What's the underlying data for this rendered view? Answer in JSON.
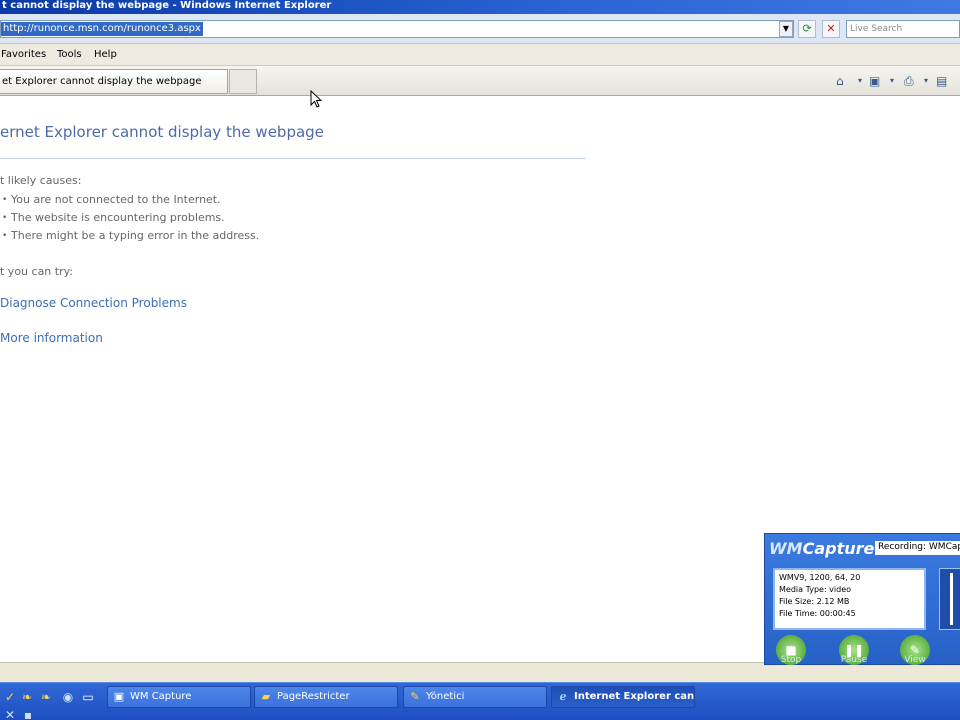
{
  "window": {
    "title": "t cannot display the webpage - Windows Internet Explorer"
  },
  "address_bar": {
    "url": "http://runonce.msn.com/runonce3.aspx",
    "search_placeholder": "Live Search"
  },
  "menu": {
    "items": [
      "Favorites",
      "Tools",
      "Help"
    ]
  },
  "tab": {
    "label": "et Explorer cannot display the webpage"
  },
  "page": {
    "heading": "ernet Explorer cannot display the webpage",
    "causes_label": "t likely causes:",
    "causes": [
      "You are not connected to the Internet.",
      "The website is encountering problems.",
      "There might be a typing error in the address."
    ],
    "try_label": "t you can try:",
    "links": [
      "Diagnose Connection Problems",
      "More information"
    ]
  },
  "wmcapture": {
    "logo_prefix": "WM",
    "logo_suffix": "Capture",
    "status": "Recording: WMCap",
    "info_lines": [
      "WMV9, 1200, 64, 20",
      "Media Type: video",
      "File Size: 2.12 MB",
      "File Time: 00:00:45"
    ],
    "buttons": [
      "Stop",
      "Pause",
      "View"
    ]
  },
  "taskbar": {
    "tasks": [
      {
        "label": "WM Capture",
        "active": false
      },
      {
        "label": "PageRestricter",
        "active": false
      },
      {
        "label": "Yönetici",
        "active": false
      },
      {
        "label": "Internet Explorer can...",
        "active": true
      }
    ]
  },
  "colors": {
    "heading": "#4e6aa6",
    "link": "#3b6eb6",
    "taskbar": "#2458c8",
    "wm_panel": "#2f6fd6"
  }
}
